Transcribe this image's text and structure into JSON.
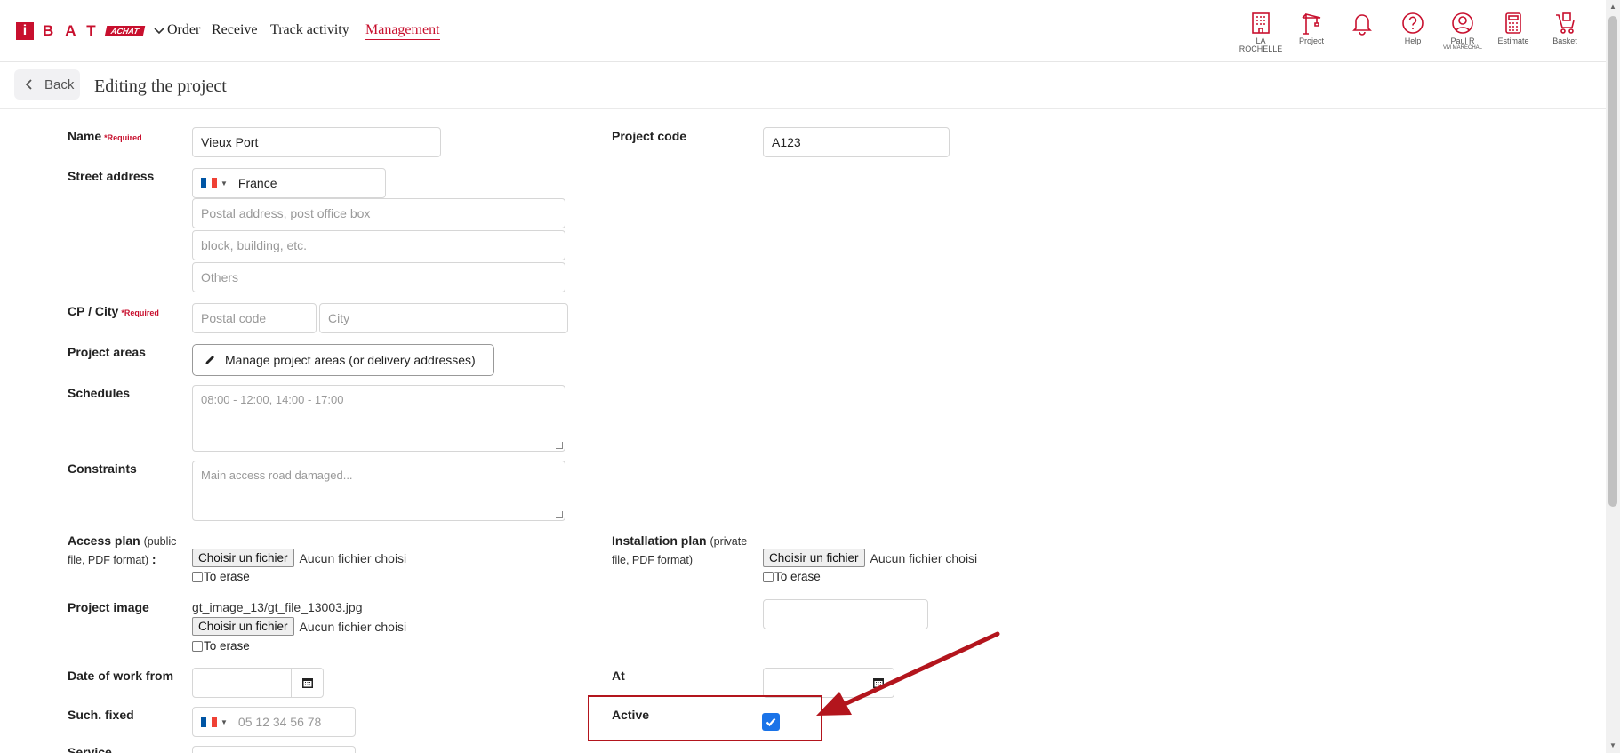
{
  "brand": {
    "initial": "i",
    "letters": "BAT",
    "tag": "ACHAT"
  },
  "nav": [
    "Order",
    "Receive",
    "Track activity",
    "Management"
  ],
  "header_icons": [
    {
      "icon": "building-icon",
      "label": "LA ROCHELLE"
    },
    {
      "icon": "crane-icon",
      "label": "Project"
    },
    {
      "icon": "bell-icon",
      "label": ""
    },
    {
      "icon": "help-icon",
      "label": "Help"
    },
    {
      "icon": "user-icon",
      "label": "Paul R",
      "sub": "VM MARECHAL"
    },
    {
      "icon": "calculator-icon",
      "label": "Estimate"
    },
    {
      "icon": "basket-icon",
      "label": "Basket"
    }
  ],
  "page": {
    "back": "Back",
    "title": "Editing the project"
  },
  "form": {
    "name_label": "Name",
    "required": "*Required",
    "name_value": "Vieux Port",
    "project_code_label": "Project code",
    "project_code_value": "A123",
    "street_label": "Street address",
    "country": "France",
    "addr1_placeholder": "Postal address, post office box",
    "addr2_placeholder": "block, building, etc.",
    "addr3_placeholder": "Others",
    "cp_city_label": "CP / City",
    "postal_placeholder": "Postal code",
    "city_placeholder": "City",
    "areas_label": "Project areas",
    "areas_button": "Manage project areas (or delivery addresses)",
    "schedules_label": "Schedules",
    "schedules_placeholder": "08:00 - 12:00, 14:00 - 17:00",
    "constraints_label": "Constraints",
    "constraints_placeholder": "Main access road damaged...",
    "access_plan_label": "Access plan",
    "access_plan_note": "(public file, PDF format)",
    "access_plan_colon": ":",
    "install_plan_label": "Installation plan",
    "install_plan_note": "(private file, PDF format)",
    "choose_file": "Choisir un fichier",
    "no_file": "Aucun fichier choisi",
    "to_erase": "To erase",
    "image_label": "Project image",
    "image_file": "gt_image_13/gt_file_13003.jpg",
    "date_from_label": "Date of work from",
    "at_label": "At",
    "phone_label": "Such. fixed",
    "phone_placeholder": "05 12 34 56 78",
    "active_label": "Active",
    "active_checked": true,
    "next_label_partial": "Service"
  },
  "colors": {
    "brand": "#c8102e",
    "highlight": "#b3151d",
    "checkbox": "#1a73e8"
  }
}
